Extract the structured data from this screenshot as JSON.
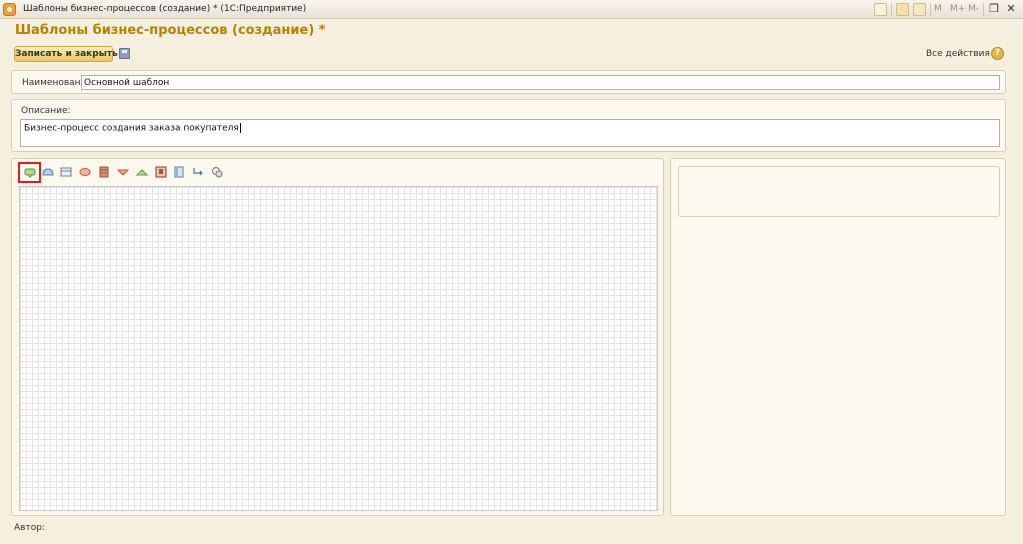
{
  "window": {
    "title": "Шаблоны бизнес-процессов (создание) * (1С:Предприятие)",
    "mem_labels": [
      "M",
      "M+",
      "M-"
    ],
    "restore_glyph": "❐",
    "close_glyph": "✕"
  },
  "form": {
    "title": "Шаблоны бизнес-процессов (создание) *",
    "save_close_label": "Записать и закрыть",
    "all_actions_label": "Все действия ▾",
    "help_label": "?"
  },
  "fields": {
    "name_label": "Наименование:",
    "name_value": "Основной шаблон",
    "description_label": "Описание:",
    "description_value": "Бизнес-процесс создания заказа покупателя"
  },
  "map_toolbar": {
    "tools": [
      {
        "name": "point-start",
        "color": "#7cc36b"
      },
      {
        "name": "point-end",
        "color": "#8fb0d6"
      },
      {
        "name": "point-action",
        "color": "#9aa6b8"
      },
      {
        "name": "point-condition",
        "color": "#e08a72"
      },
      {
        "name": "point-processing",
        "color": "#c67a5a"
      },
      {
        "name": "point-split",
        "color": "#e07f5b"
      },
      {
        "name": "point-merge",
        "color": "#82bd64"
      },
      {
        "name": "point-subprocess",
        "color": "#b04f3b"
      },
      {
        "name": "decoration",
        "color": "#6f8fb8"
      },
      {
        "name": "connector",
        "color": "#5c7a9e"
      },
      {
        "name": "group",
        "color": "#8a8a8a"
      }
    ]
  },
  "footer": {
    "author_label": "Автор:"
  },
  "colors": {
    "accent": "#b58100",
    "selection": "#e01b1b",
    "background": "#f4efde"
  }
}
